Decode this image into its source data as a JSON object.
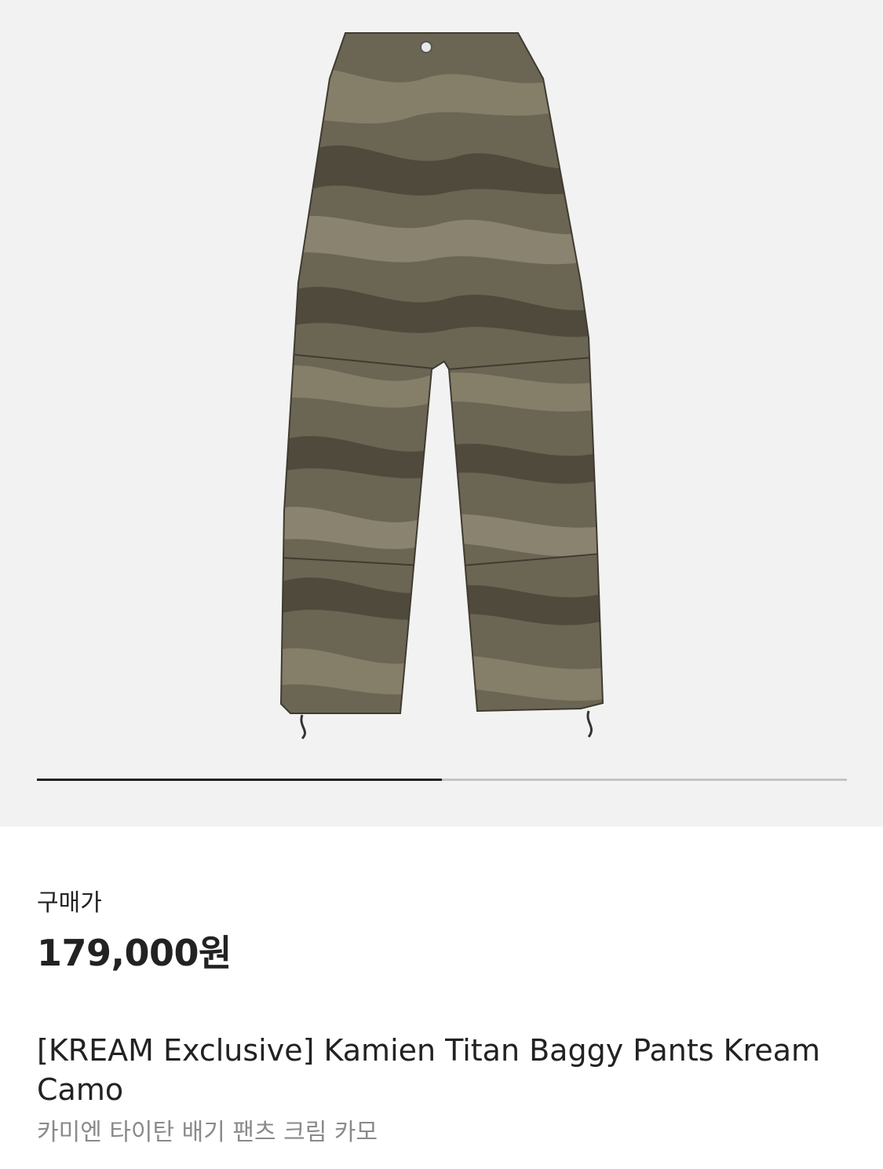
{
  "product": {
    "image_name": "camo-cargo-pants-image",
    "image_count_progress": 0.5,
    "price_label": "구매가",
    "price": "179,000원",
    "title_en": "[KREAM Exclusive] Kamien Titan Baggy Pants Kream Camo",
    "title_ko": "카미엔 타이탄 배기 팬츠 크림 카모"
  },
  "colors": {
    "image_bg": "#f2f2f2",
    "camo_base": "#6b6554",
    "camo_dark": "#4f4a3c",
    "camo_light": "#8a8370",
    "pager_active": "#222222",
    "pager_inactive": "#c4c4c4",
    "subtitle": "#8a8a8a"
  }
}
